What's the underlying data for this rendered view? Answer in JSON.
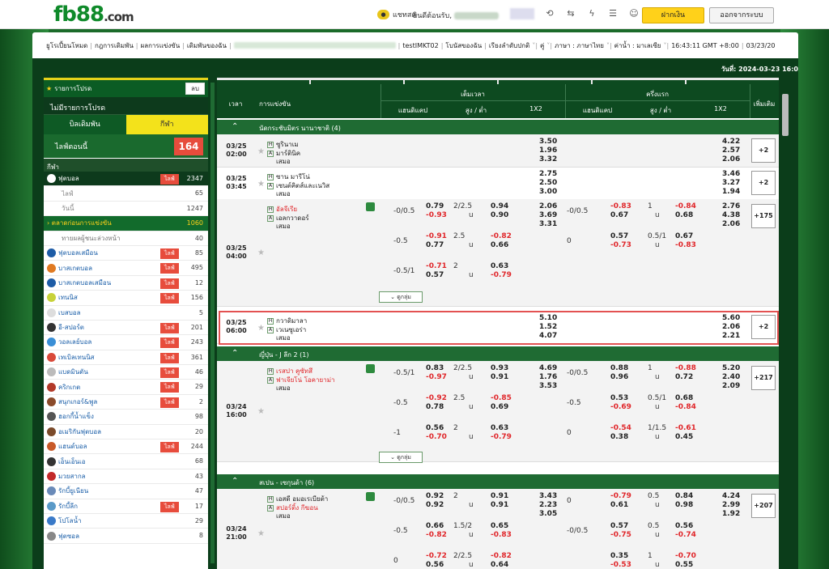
{
  "header": {
    "logo_main": "fb88",
    "logo_tld": ".com",
    "chat": "แชทสด",
    "welcome": "ยินดีต้อนรับ,",
    "deposit": "ฝากเงิน",
    "logout": "ออกจากระบบ"
  },
  "nav": {
    "items": [
      "ยูโรเปี้ยนโหมด",
      "กฎการเดิมพัน",
      "ผลการแข่งขัน",
      "เดิมพันของฉัน",
      "testIMKT02",
      "โบนัสของฉัน",
      "เรียงลำดับปกติ",
      "คู่",
      "ภาษา : ภาษาไทย",
      "ค่าน้ำ : มาเลเซีย",
      "16:43:11 GMT +8:00",
      "03/23/20"
    ]
  },
  "date_bar": "วันที่: 2024-03-23 16:0",
  "sidebar": {
    "parlay_title": "รายการโปรด",
    "close": "ลบ",
    "no_parlay": "ไม่มีรายการโปรด",
    "tab_bet": "บิลเดิมพัน",
    "tab_sport": "กีฬา",
    "live_label": "ไลฟ์ตอนนี้",
    "live_count": "164",
    "sport_header": "กีฬา",
    "items": [
      {
        "label": "ฟุตบอล",
        "live": "ไลฟ์",
        "count": "2347",
        "kind": "dark",
        "icon": "soccer-icon",
        "color": "#fff"
      },
      {
        "label": "ไลฟ์",
        "live": "",
        "count": "65",
        "kind": "sub",
        "icon": "",
        "color": ""
      },
      {
        "label": "วันนี้",
        "live": "",
        "count": "1247",
        "kind": "sub",
        "icon": "",
        "color": ""
      },
      {
        "label": "› ตลาดก่อนการแข่งขัน",
        "live": "",
        "count": "1060",
        "kind": "act",
        "icon": "",
        "color": ""
      },
      {
        "label": "ทายผลผู้ชนะล่วงหน้า",
        "live": "",
        "count": "40",
        "kind": "sub2",
        "icon": "",
        "color": ""
      },
      {
        "label": "ฟุตบอลเสมือน",
        "live": "ไลฟ์",
        "count": "85",
        "kind": "",
        "icon": "virtual-soccer-icon",
        "color": "#1e5ca6"
      },
      {
        "label": "บาสเกตบอล",
        "live": "ไลฟ์",
        "count": "495",
        "kind": "",
        "icon": "basketball-icon",
        "color": "#e07a22"
      },
      {
        "label": "บาสเกตบอลเสมือน",
        "live": "ไลฟ์",
        "count": "12",
        "kind": "",
        "icon": "virtual-basketball-icon",
        "color": "#1e5ca6"
      },
      {
        "label": "เทนนิส",
        "live": "ไลฟ์",
        "count": "156",
        "kind": "",
        "icon": "tennis-icon",
        "color": "#c8d23a"
      },
      {
        "label": "เบสบอล",
        "live": "",
        "count": "5",
        "kind": "",
        "icon": "baseball-icon",
        "color": "#ddd"
      },
      {
        "label": "อี-สปอร์ต",
        "live": "ไลฟ์",
        "count": "201",
        "kind": "",
        "icon": "esports-icon",
        "color": "#333"
      },
      {
        "label": "วอลเลย์บอล",
        "live": "ไลฟ์",
        "count": "243",
        "kind": "",
        "icon": "volleyball-icon",
        "color": "#3a8fd6"
      },
      {
        "label": "เทเบิลเทนนิส",
        "live": "ไลฟ์",
        "count": "361",
        "kind": "",
        "icon": "table-tennis-icon",
        "color": "#d94a3a"
      },
      {
        "label": "แบดมินตัน",
        "live": "ไลฟ์",
        "count": "46",
        "kind": "",
        "icon": "badminton-icon",
        "color": "#bbb"
      },
      {
        "label": "คริกเกต",
        "live": "ไลฟ์",
        "count": "29",
        "kind": "",
        "icon": "cricket-icon",
        "color": "#b23a2a"
      },
      {
        "label": "สนุกเกอร์&พูล",
        "live": "ไลฟ์",
        "count": "2",
        "kind": "",
        "icon": "snooker-icon",
        "color": "#8a4a2a"
      },
      {
        "label": "ฮอกกี้น้ำแข็ง",
        "live": "",
        "count": "98",
        "kind": "",
        "icon": "ice-hockey-icon",
        "color": "#555"
      },
      {
        "label": "อเมริกันฟุตบอล",
        "live": "",
        "count": "20",
        "kind": "",
        "icon": "american-football-icon",
        "color": "#7a4a2a"
      },
      {
        "label": "แฮนด์บอล",
        "live": "ไลฟ์",
        "count": "244",
        "kind": "",
        "icon": "handball-icon",
        "color": "#c85a2a"
      },
      {
        "label": "เอ็นเอ็นเอ",
        "live": "",
        "count": "68",
        "kind": "",
        "icon": "mma-icon",
        "color": "#333"
      },
      {
        "label": "มวยสากล",
        "live": "",
        "count": "43",
        "kind": "",
        "icon": "boxing-icon",
        "color": "#c22a2a"
      },
      {
        "label": "รักบี้ยูเนียน",
        "live": "",
        "count": "47",
        "kind": "",
        "icon": "rugby-union-icon",
        "color": "#6a8ab8"
      },
      {
        "label": "รักบี้ลีก",
        "live": "ไลฟ์",
        "count": "17",
        "kind": "",
        "icon": "rugby-league-icon",
        "color": "#5a9ac8"
      },
      {
        "label": "โปโลน้ำ",
        "live": "",
        "count": "29",
        "kind": "",
        "icon": "water-polo-icon",
        "color": "#3a7ac8"
      },
      {
        "label": "ฟุตซอล",
        "live": "",
        "count": "8",
        "kind": "",
        "icon": "futsal-icon",
        "color": "#888"
      }
    ]
  },
  "table": {
    "h_time": "เวลา",
    "h_match": "การแข่งขัน",
    "h_full": "เต็มเวลา",
    "h_half": "ครึ่งแรก",
    "h_hdp": "แฮนดิแคป",
    "h_ou": "สูง / ต่ำ",
    "h_1x2": "1X2",
    "h_more": "เพิ่มเติม",
    "expand_label": "ดูกลุ่ม",
    "groups": [
      {
        "title": "นัดกระชับมิตร นานาชาติ (4)"
      },
      {
        "title": "ญี่ปุ่น - J ลีก 2 (1)"
      },
      {
        "title": "สเปน - เซกุนด้า (6)"
      }
    ],
    "matches": [
      {
        "date": "03/25",
        "time": "02:00",
        "home": "ซูรินาเม",
        "away": "มาร์ตินิค",
        "draw": "เสมอ",
        "ft1x2": [
          "3.50",
          "1.96",
          "3.32"
        ],
        "ht1x2": [
          "4.22",
          "2.57",
          "2.06"
        ],
        "more": "+2"
      },
      {
        "date": "03/25",
        "time": "03:45",
        "home": "ซาน มารีโน่",
        "away": "เซนต์คิตส์และเนวิส",
        "draw": "เสมอ",
        "ft1x2": [
          "2.75",
          "2.50",
          "3.00"
        ],
        "ht1x2": [
          "3.46",
          "3.27",
          "1.94"
        ],
        "more": "+2"
      },
      {
        "date": "03/25",
        "time": "04:00",
        "home": "อัลจีเรีย",
        "away": "เอลกวาดอร์",
        "draw": "เสมอ",
        "ft1x2": [
          "2.06",
          "3.69",
          "3.31"
        ],
        "ht1x2": [
          "2.76",
          "4.38",
          "2.06"
        ],
        "more": "+175",
        "lines": [
          {
            "fh": "-0/0.5",
            "fh1": "0.79",
            "fh2": "-0.93",
            "fo": "2/2.5",
            "fu": "u",
            "fo1": "0.94",
            "fo2": "0.90",
            "hh": "-0/0.5",
            "hh1": "-0.83",
            "hh2": "0.67",
            "ho": "1",
            "hu": "u",
            "ho1": "-0.84",
            "ho2": "0.68"
          },
          {
            "fh": "-0.5",
            "fh1": "-0.91",
            "fh2": "0.77",
            "fo": "2.5",
            "fu": "u",
            "fo1": "-0.82",
            "fo2": "0.66",
            "hh": "0",
            "hh1": "0.57",
            "hh2": "-0.73",
            "ho": "0.5/1",
            "hu": "u",
            "ho1": "0.67",
            "ho2": "-0.83"
          },
          {
            "fh": "-0.5/1",
            "fh1": "-0.71",
            "fh2": "0.57",
            "fo": "2",
            "fu": "u",
            "fo1": "0.63",
            "fo2": "-0.79",
            "hh": "",
            "hh1": "",
            "hh2": "",
            "ho": "",
            "hu": "",
            "ho1": "",
            "ho2": ""
          }
        ]
      },
      {
        "date": "03/25",
        "time": "06:00",
        "home": "กวาดิมาลา",
        "away": "เวเนซูเอร่า",
        "draw": "เสมอ",
        "ft1x2": [
          "5.10",
          "1.52",
          "4.07"
        ],
        "ht1x2": [
          "5.60",
          "2.06",
          "2.21"
        ],
        "more": "+2"
      },
      {
        "date": "03/24",
        "time": "16:00",
        "home": "เรสปา คูซัทสึ",
        "away": "ฟาเจียโน่ โอคายาม่า",
        "draw": "เสมอ",
        "ft1x2": [
          "4.69",
          "1.76",
          "3.53"
        ],
        "ht1x2": [
          "5.20",
          "2.40",
          "2.09"
        ],
        "more": "+217",
        "lines": [
          {
            "fh": "-0.5/1",
            "fh1": "0.83",
            "fh2": "-0.97",
            "fo": "2/2.5",
            "fu": "u",
            "fo1": "0.93",
            "fo2": "0.91",
            "hh": "-0/0.5",
            "hh1": "0.88",
            "hh2": "0.96",
            "ho": "1",
            "hu": "u",
            "ho1": "-0.88",
            "ho2": "0.72"
          },
          {
            "fh": "-0.5",
            "fh1": "-0.92",
            "fh2": "0.78",
            "fo": "2.5",
            "fu": "u",
            "fo1": "-0.85",
            "fo2": "0.69",
            "hh": "-0.5",
            "hh1": "0.53",
            "hh2": "-0.69",
            "ho": "0.5/1",
            "hu": "u",
            "ho1": "0.68",
            "ho2": "-0.84"
          },
          {
            "fh": "-1",
            "fh1": "0.56",
            "fh2": "-0.70",
            "fo": "2",
            "fu": "u",
            "fo1": "0.63",
            "fo2": "-0.79",
            "hh": "0",
            "hh1": "-0.54",
            "hh2": "0.38",
            "ho": "1/1.5",
            "hu": "u",
            "ho1": "-0.61",
            "ho2": "0.45"
          }
        ]
      },
      {
        "date": "03/24",
        "time": "21:00",
        "home": "เอสดี อมอเรเบียต้า",
        "away": "สปอร์ติ้ง กีฆอน",
        "draw": "เสมอ",
        "ft1x2": [
          "3.43",
          "2.23",
          "3.05"
        ],
        "ht1x2": [
          "4.24",
          "2.99",
          "1.92"
        ],
        "more": "+207",
        "lines": [
          {
            "fh": "-0/0.5",
            "fh1": "0.92",
            "fh2": "0.92",
            "fo": "2",
            "fu": "u",
            "fo1": "0.91",
            "fo2": "0.91",
            "hh": "0",
            "hh1": "-0.79",
            "hh2": "0.61",
            "ho": "0.5",
            "hu": "u",
            "ho1": "0.84",
            "ho2": "0.98"
          },
          {
            "fh": "-0.5",
            "fh1": "0.66",
            "fh2": "-0.82",
            "fo": "1.5/2",
            "fu": "u",
            "fo1": "0.65",
            "fo2": "-0.83",
            "hh": "-0/0.5",
            "hh1": "0.57",
            "hh2": "-0.75",
            "ho": "0.5",
            "hu": "u",
            "ho1": "0.56",
            "ho2": "-0.74"
          },
          {
            "fh": "0",
            "fh1": "-0.72",
            "fh2": "0.56",
            "fo": "2/2.5",
            "fu": "u",
            "fo1": "-0.82",
            "fo2": "0.64",
            "hh": "",
            "hh1": "0.35",
            "hh2": "-0.53",
            "ho": "1",
            "hu": "u",
            "ho1": "-0.70",
            "ho2": "0.55"
          }
        ]
      }
    ]
  }
}
